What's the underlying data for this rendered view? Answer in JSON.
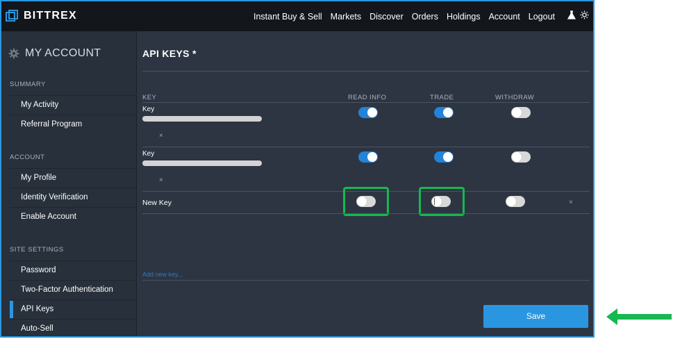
{
  "app": {
    "logo_text": "BITTREX"
  },
  "nav": {
    "items": [
      "Instant Buy & Sell",
      "Markets",
      "Discover",
      "Orders",
      "Holdings",
      "Account"
    ],
    "logout": "Logout",
    "icons": [
      "flask-icon",
      "sun-icon"
    ]
  },
  "sidebar": {
    "title": "MY ACCOUNT",
    "sections": [
      {
        "heading": "SUMMARY",
        "items": [
          "My Activity",
          "Referral Program"
        ]
      },
      {
        "heading": "ACCOUNT",
        "items": [
          "My Profile",
          "Identity Verification",
          "Enable Account"
        ]
      },
      {
        "heading": "SITE SETTINGS",
        "items": [
          "Password",
          "Two-Factor Authentication",
          "API Keys",
          "Auto-Sell"
        ]
      }
    ],
    "active_item": "API Keys"
  },
  "main": {
    "title": "API KEYS *",
    "columns": [
      "KEY",
      "READ INFO",
      "TRADE",
      "WITHDRAW"
    ],
    "keys": [
      {
        "label": "Key",
        "read_info": true,
        "trade": true,
        "withdraw": false,
        "delete": "×"
      },
      {
        "label": "Key",
        "read_info": true,
        "trade": true,
        "withdraw": false,
        "delete": "×"
      }
    ],
    "new_key": {
      "label": "New Key",
      "read_info": false,
      "trade": false,
      "withdraw": false,
      "delete": "×"
    },
    "add_link": "Add new key...",
    "save_label": "Save"
  },
  "colors": {
    "accent": "#2b96e0",
    "highlight": "#16b84f",
    "toggle_on": "#2383d8",
    "toggle_off": "#d8d8d8",
    "background": "#2d3542"
  }
}
